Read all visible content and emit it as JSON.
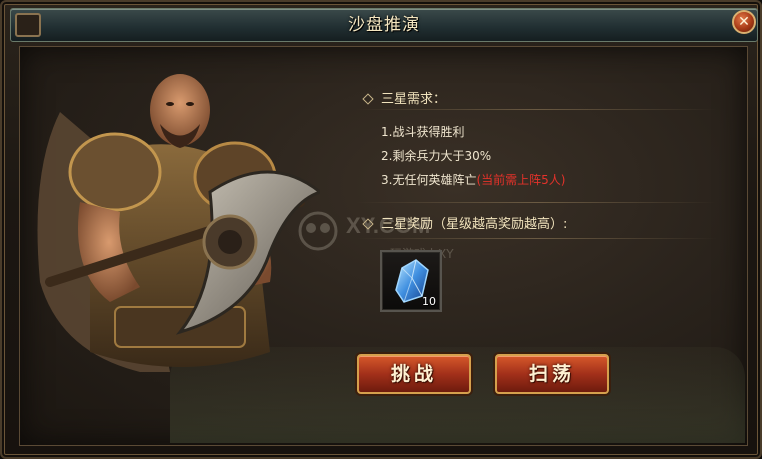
{
  "window": {
    "title": "沙盘推演",
    "close_symbol": "✕"
  },
  "requirements": {
    "heading": "三星需求：",
    "items": [
      "1.战斗获得胜利",
      "2.剩余兵力大于30%",
      "3.无任何英雄阵亡"
    ],
    "item3_note": "(当前需上阵5人)"
  },
  "rewards": {
    "heading": "三星奖励（星级越高奖励越高）:",
    "items": [
      {
        "icon": "blue-crystal-icon",
        "count": "10"
      }
    ]
  },
  "watermark": {
    "text": "XY.COM",
    "sub": "玩游戏上XY"
  },
  "buttons": {
    "challenge": "挑战",
    "sweep": "扫荡"
  },
  "colors": {
    "title_bar": "#223033",
    "button": "#a2301a",
    "button_border": "#d5a04d",
    "warning_text": "#e3322a",
    "body_text": "#f0e6cf"
  }
}
